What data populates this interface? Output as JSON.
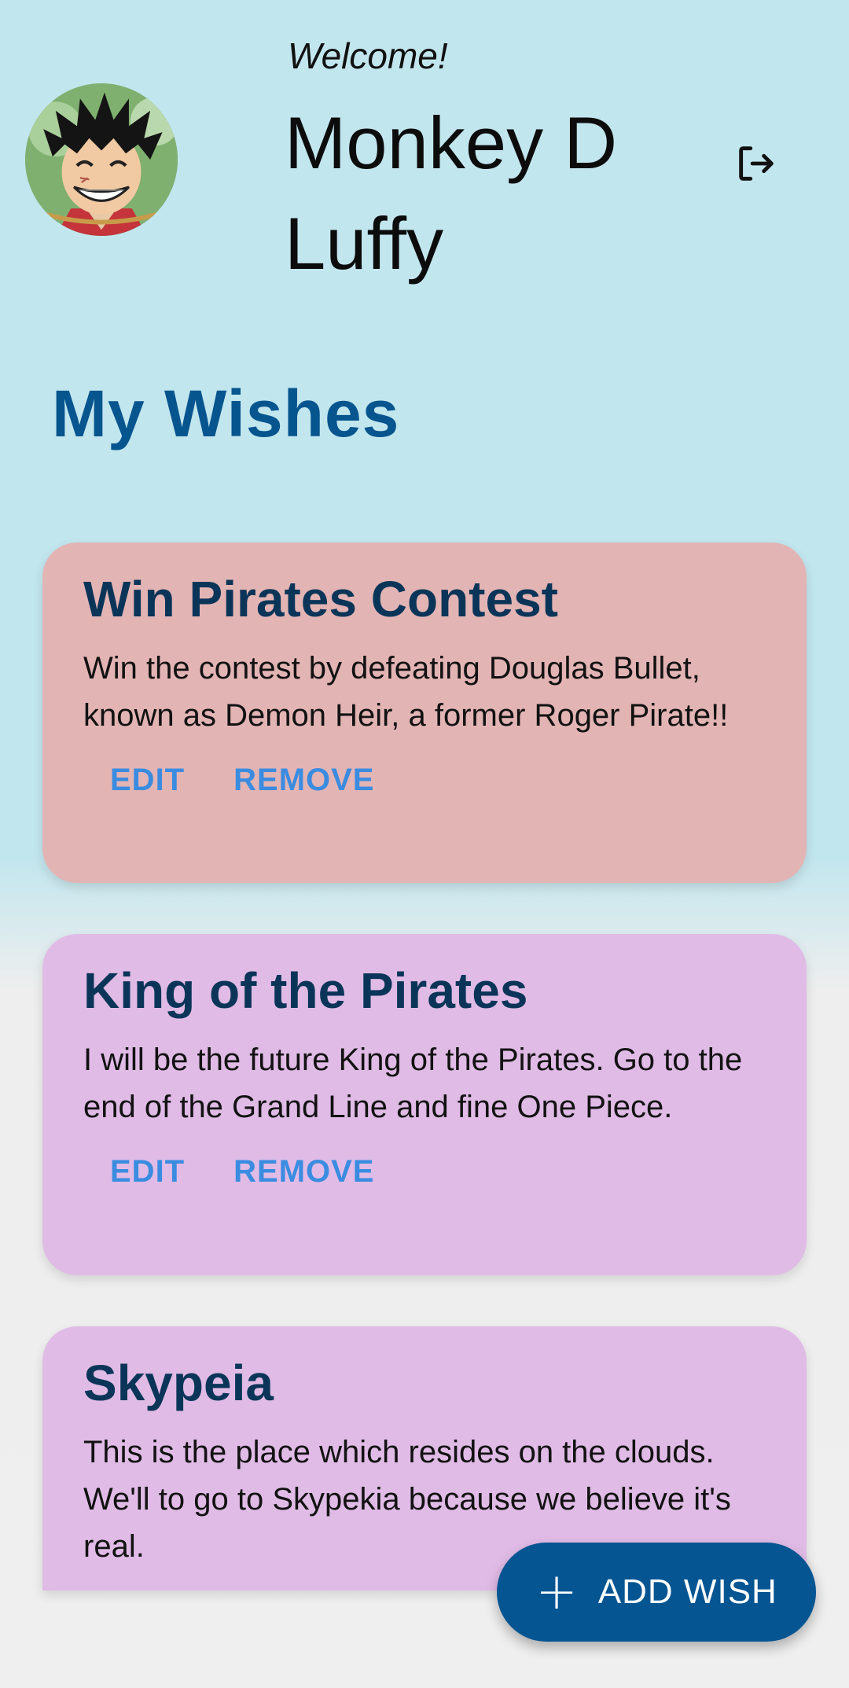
{
  "header": {
    "welcome_text": "Welcome!",
    "user_name": "Monkey D Luffy",
    "logout_icon": "logout-icon",
    "avatar_icon": "avatar-luffy"
  },
  "page": {
    "title": "My Wishes"
  },
  "wishes": [
    {
      "title": "Win Pirates Contest",
      "description": "Win the contest by defeating Douglas Bullet, known as Demon Heir, a former Roger Pirate!!",
      "edit_label": "EDIT",
      "remove_label": "REMOVE",
      "color": "#e3b4b4"
    },
    {
      "title": "King of the Pirates",
      "description": "I will be the future King of the Pirates. Go to the end of the Grand Line and fine One Piece.",
      "edit_label": "EDIT",
      "remove_label": "REMOVE",
      "color": "#e0bbe6"
    },
    {
      "title": "Skypeia",
      "description": "This is the place which resides on the clouds. We'll to go to Skypekia because we believe it's real.",
      "color": "#e0bbe6"
    }
  ],
  "fab": {
    "icon": "plus-icon",
    "icon_glyph": "+",
    "label": "ADD WISH",
    "color": "#055592"
  },
  "colors": {
    "title_blue": "#07558f",
    "action_blue": "#3a8ce0",
    "background_top": "#c2e6ee",
    "background_bottom": "#efefef"
  }
}
